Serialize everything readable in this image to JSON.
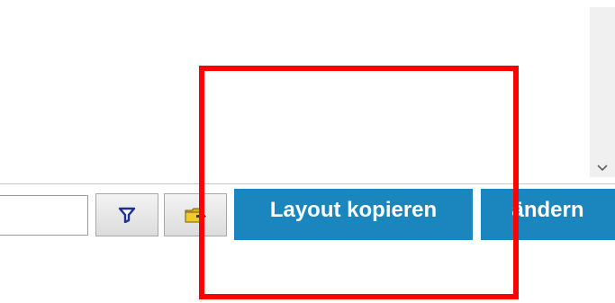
{
  "toolbar": {
    "filter_input": {
      "value": "",
      "placeholder": ""
    },
    "filter_icon": "filter-funnel-icon",
    "folder_icon": "folder-load-icon",
    "copy_layout_label": "Layout kopieren",
    "change_label": "ändern"
  },
  "scrollbar": {
    "down_icon": "chevron-down-icon"
  },
  "colors": {
    "button_blue": "#1b86bd",
    "highlight_red": "#ff0000",
    "filter_icon_blue": "#1a2f9a",
    "folder_yellow": "#f2cb2a"
  }
}
